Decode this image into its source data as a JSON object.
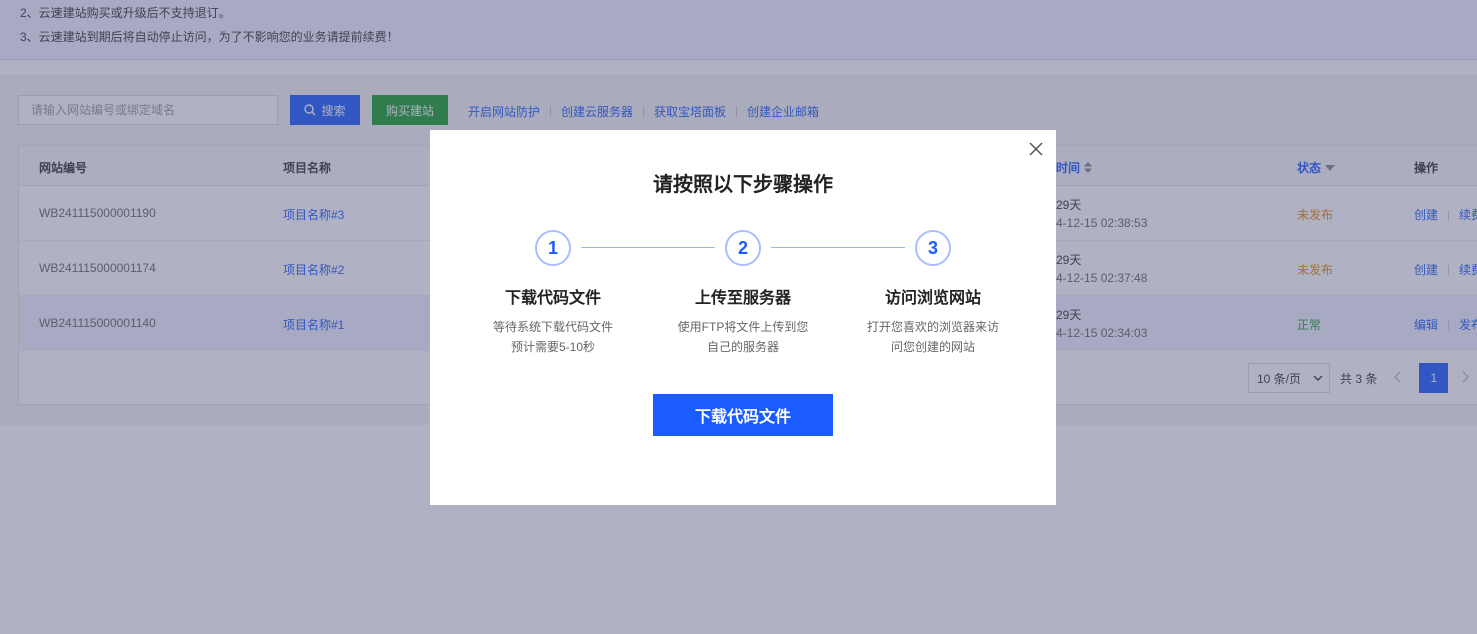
{
  "notice": {
    "line2": "2、云速建站购买或升级后不支持退订。",
    "line3": "3、云速建站到期后将自动停止访问，为了不影响您的业务请提前续费！"
  },
  "toolbar": {
    "search_placeholder": "请输入网站编号或绑定域名",
    "search_button": "搜索",
    "buy_button": "购买建站",
    "links": [
      "开启网站防护",
      "创建云服务器",
      "获取宝塔面板",
      "创建企业邮箱"
    ]
  },
  "table": {
    "headers": {
      "id": "网站编号",
      "name": "项目名称",
      "expire": "时间",
      "status": "状态",
      "ops": "操作"
    },
    "rows": [
      {
        "id": "WB241115000001190",
        "name": "项目名称#3",
        "days": "29天",
        "date": "4-12-15 02:38:53",
        "status": "未发布",
        "op1": "创建",
        "op2": "续费"
      },
      {
        "id": "WB241115000001174",
        "name": "项目名称#2",
        "days": "29天",
        "date": "4-12-15 02:37:48",
        "status": "未发布",
        "op1": "创建",
        "op2": "续费"
      },
      {
        "id": "WB241115000001140",
        "name": "项目名称#1",
        "days": "29天",
        "date": "4-12-15 02:34:03",
        "status": "正常",
        "op1": "编辑",
        "op2": "发布"
      }
    ]
  },
  "pagination": {
    "page_size": "10 条/页",
    "total": "共 3 条",
    "current_page": "1"
  },
  "modal": {
    "title": "请按照以下步骤操作",
    "steps": [
      {
        "num": "1",
        "title": "下载代码文件",
        "desc1": "等待系统下载代码文件",
        "desc2": "预计需要5-10秒"
      },
      {
        "num": "2",
        "title": "上传至服务器",
        "desc1": "使用FTP将文件上传到您",
        "desc2": "自己的服务器"
      },
      {
        "num": "3",
        "title": "访问浏览网站",
        "desc1": "打开您喜欢的浏览器来访",
        "desc2": "问您创建的网站"
      }
    ],
    "button": "下载代码文件"
  },
  "colors": {
    "primary": "#1a5cff",
    "buy_green": "#169e2a",
    "status_unpublished": "#e08a00",
    "status_normal": "#169e2a",
    "overlay": "rgba(80,82,120,0.45)"
  }
}
